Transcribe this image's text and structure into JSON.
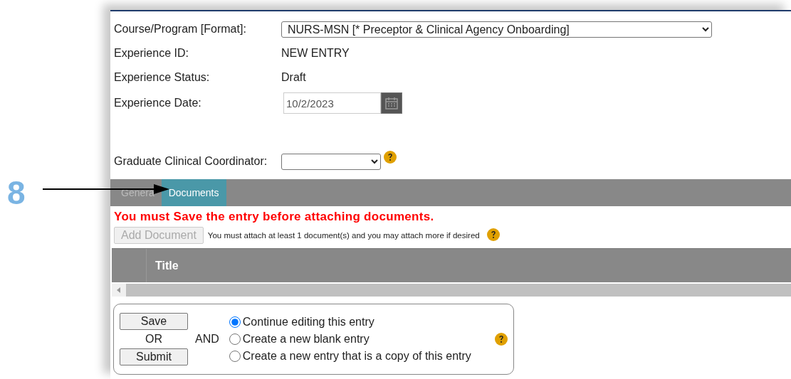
{
  "annotation": {
    "number": "8"
  },
  "form": {
    "fields": [
      {
        "kind": "select",
        "label": "Course/Program [Format]:",
        "value": "NURS-MSN [* Preceptor & Clinical Agency Onboarding]",
        "help": false
      },
      {
        "kind": "text",
        "label": "Experience ID:",
        "value": "NEW ENTRY",
        "help": false
      },
      {
        "kind": "text",
        "label": "Experience Status:",
        "value": "Draft",
        "help": false
      },
      {
        "kind": "date",
        "label": "Experience Date:",
        "value": "10/2/2023",
        "help": false
      },
      {
        "kind": "select",
        "label": "Graduate Clinical Coordinator:",
        "help": true
      }
    ]
  },
  "tabs": [
    {
      "label": "Genera",
      "selected": false
    },
    {
      "label": "Documents",
      "selected": true
    }
  ],
  "documents": {
    "warning": "You must Save the entry before attaching documents.",
    "add_button": {
      "label": "Add Document",
      "disabled": true
    },
    "note": "You must attach at least 1 document(s) and you may attach more if desired",
    "table": {
      "columns": [
        "Title"
      ]
    }
  },
  "actions": {
    "buttons": [
      "Save",
      "Submit"
    ],
    "or": "OR",
    "and": "AND",
    "options": [
      {
        "label": "Continue editing this entry",
        "selected": true
      },
      {
        "label": "Create a new blank entry",
        "selected": false
      },
      {
        "label": "Create a new entry that is a copy of this entry",
        "selected": false
      }
    ]
  }
}
